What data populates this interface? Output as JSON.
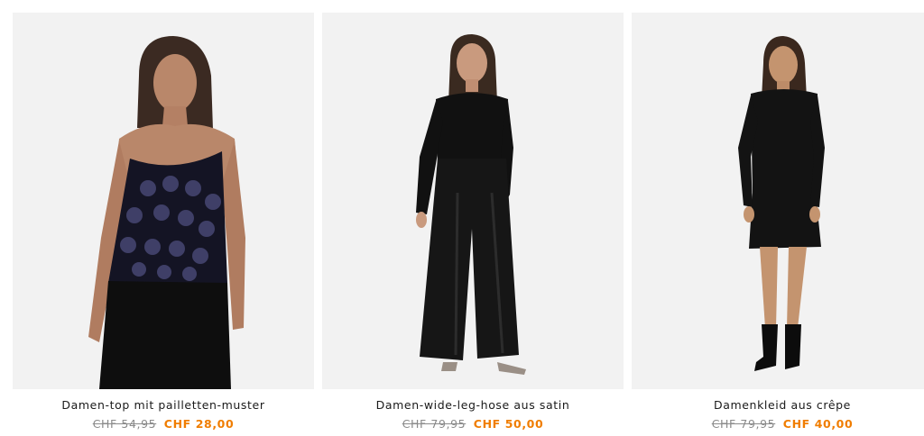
{
  "colors": {
    "sale_price": "#f07d00",
    "old_price": "#8a8a8a",
    "photo_bg": "#f2f2f2"
  },
  "products": [
    {
      "name": "Damen-top mit pailletten-muster",
      "old_price": "CHF 54,95",
      "new_price": "CHF 28,00",
      "image": "woman in black sequin camisole and black trousers"
    },
    {
      "name": "Damen-wide-leg-hose aus satin",
      "old_price": "CHF 79,95",
      "new_price": "CHF 50,00",
      "image": "woman in black sweater and black satin wide-leg trousers"
    },
    {
      "name": "Damenkleid aus crêpe",
      "old_price": "CHF 79,95",
      "new_price": "CHF 40,00",
      "image": "woman in black long-sleeve crêpe dress with black boots"
    }
  ]
}
